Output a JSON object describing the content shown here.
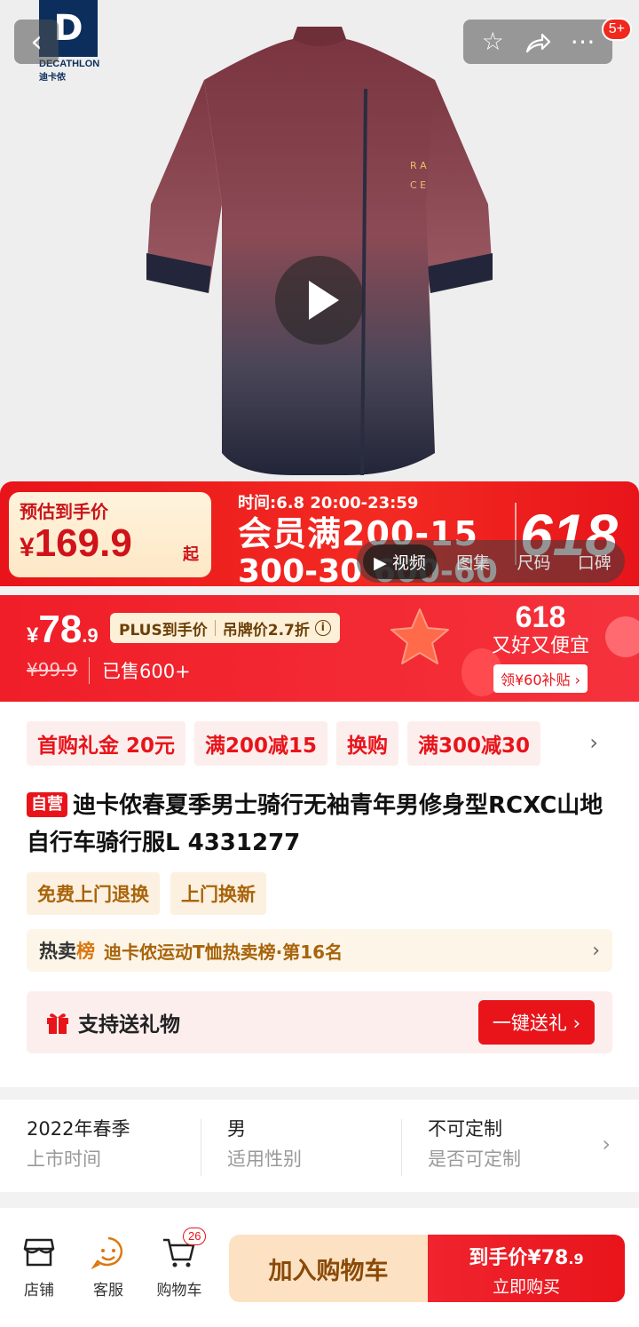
{
  "brand": {
    "name": "DECATHLON",
    "name_cn": "迪卡侬",
    "mark": "D"
  },
  "top_bar": {
    "badge": "5+"
  },
  "promo_banner": {
    "label": "预估到手价",
    "price_yen": "¥",
    "price": "169.9",
    "price_suffix": "起",
    "time": "时间:6.8 20:00-23:59",
    "line1": "会员满200-15",
    "line2": "300-30 600-60",
    "event": "618"
  },
  "media_tabs": [
    "视频",
    "图集",
    "尺码",
    "口碑"
  ],
  "price_bar": {
    "yen": "¥",
    "price_int": "78",
    "price_dec": ".9",
    "plus_label": "PLUS到手价",
    "tag_label": "吊牌价2.7折",
    "original_price": "¥99.9",
    "sold": "已售600+",
    "event_number": "618",
    "event_slogan": "又好又便宜",
    "coupon": "领¥60补贴 ›"
  },
  "coupons": [
    "首购礼金  20元",
    "满200减15",
    "换购",
    "满300减30"
  ],
  "product": {
    "self_tag": "自营",
    "title": "迪卡侬春夏季男士骑行无袖青年男修身型RCXC山地自行车骑行服L 4331277"
  },
  "services": [
    "免费上门退换",
    "上门换新"
  ],
  "hot_rank": {
    "title_a": "热卖",
    "title_b": "榜",
    "text": "迪卡侬运动T恤热卖榜·第16名"
  },
  "gift": {
    "label": "支持送礼物",
    "button": "一键送礼 ›"
  },
  "specs": [
    {
      "value": "2022年春季",
      "key": "上市时间"
    },
    {
      "value": "男",
      "key": "适用性别"
    },
    {
      "value": "不可定制",
      "key": "是否可定制"
    }
  ],
  "bottom_nav": {
    "store": "店铺",
    "service": "客服",
    "cart": "购物车",
    "cart_count": "26",
    "add_to_cart": "加入购物车",
    "buy_price_label": "到手价¥78",
    "buy_price_dec": ".9",
    "buy_now": "立即购买"
  },
  "colors": {
    "accent": "#e8141a",
    "brand_blue": "#0b2e5c",
    "gold": "#a8640a"
  }
}
